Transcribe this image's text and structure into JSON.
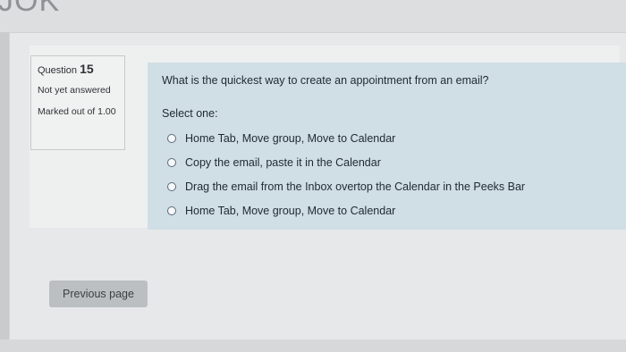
{
  "header": {
    "partial_text": "JOK"
  },
  "question_info": {
    "question_label": "Question",
    "question_number": "15",
    "state": "Not yet answered",
    "grade": "Marked out of 1.00"
  },
  "question": {
    "text": "What is the quickest way to create an appointment from an email?",
    "prompt": "Select one:",
    "options": [
      "Home Tab, Move group, Move to Calendar",
      "Copy the email, paste it in the Calendar",
      "Drag the email from the Inbox overtop the Calendar in the Peeks Bar",
      "Home Tab, Move group, Move to Calendar"
    ]
  },
  "navigation": {
    "previous_label": "Previous page"
  }
}
